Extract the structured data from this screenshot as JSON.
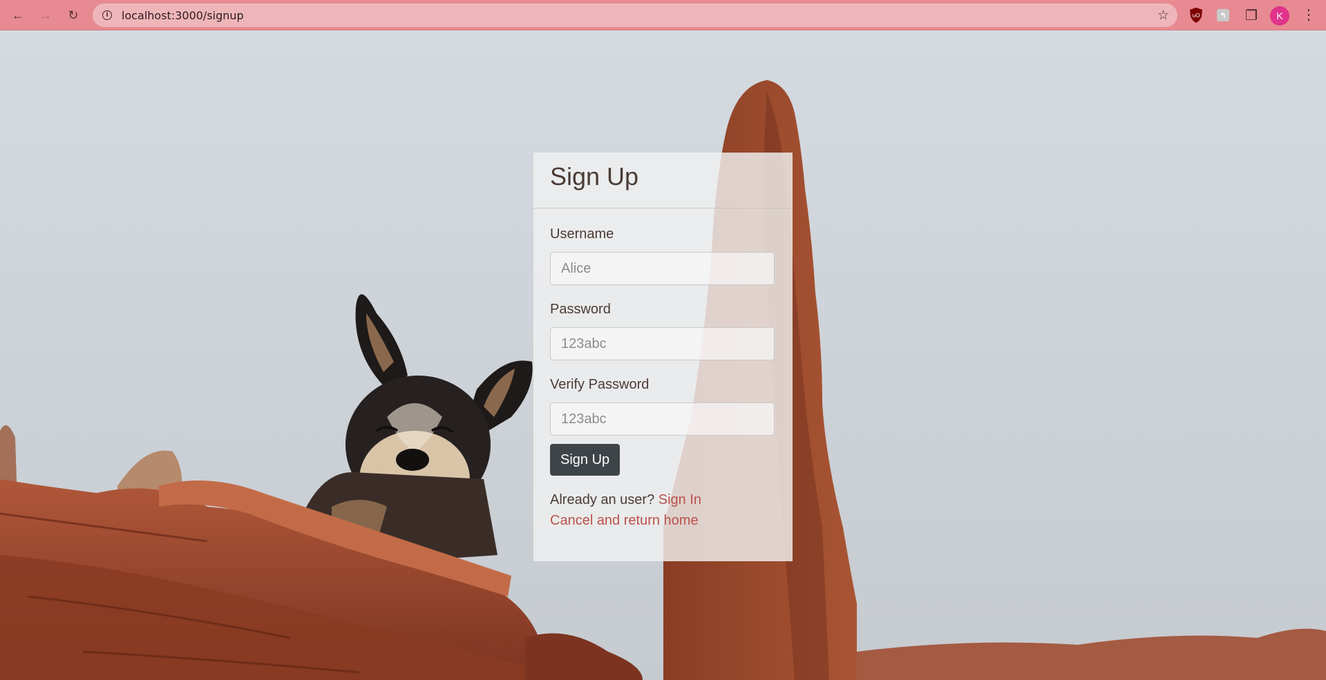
{
  "browser": {
    "url": "localhost:3000/signup",
    "avatar_initial": "K",
    "icons": {
      "back": "arrow-left-icon",
      "forward": "arrow-right-icon",
      "reload": "reload-icon",
      "site_info": "info-icon",
      "bookmark": "star-icon",
      "extensions": "puzzle-icon",
      "menu": "kebab-menu-icon"
    },
    "colors": {
      "toolbar": "#e78a91",
      "omnibox": "#efb6ba",
      "avatar": "#e0338a"
    }
  },
  "form": {
    "title": "Sign Up",
    "fields": [
      {
        "label": "Username",
        "placeholder": "Alice"
      },
      {
        "label": "Password",
        "placeholder": "123abc"
      },
      {
        "label": "Verify Password",
        "placeholder": "123abc"
      }
    ],
    "submit_label": "Sign Up",
    "already_text": "Already an user?",
    "sign_in_link": "Sign In",
    "cancel_link": "Cancel and return home",
    "colors": {
      "button": "#3e4448",
      "link": "#b9514a"
    }
  }
}
